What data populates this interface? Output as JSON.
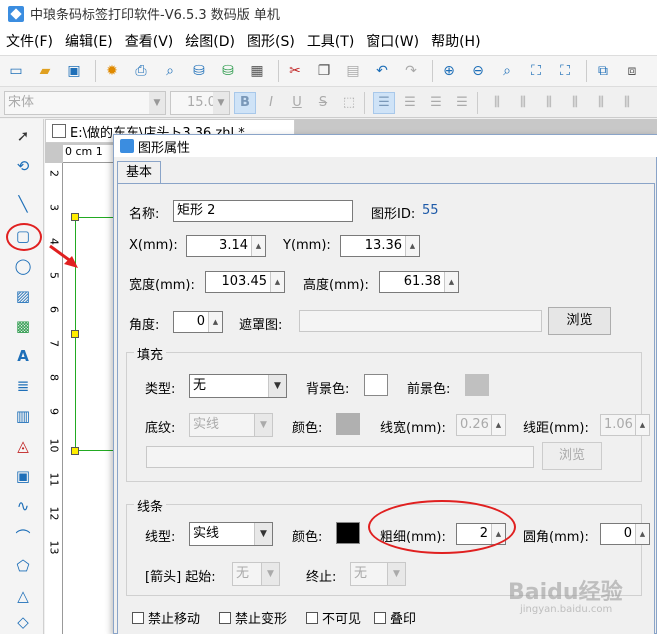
{
  "app": {
    "title": "中琅条码标签打印软件-V6.5.3 数码版 单机"
  },
  "menu": [
    "文件(F)",
    "编辑(E)",
    "查看(V)",
    "绘图(D)",
    "图形(S)",
    "工具(T)",
    "窗口(W)",
    "帮助(H)"
  ],
  "fontbar": {
    "font": "宋体",
    "size": "15.0",
    "bold": "B",
    "italic": "I",
    "underline": "U",
    "strike": "S"
  },
  "document": {
    "tab_title": "E:\\做的东东\\店头ト3.36.zhl *",
    "ruler_unit": "0 cm 1",
    "ruler_numbers": [
      "2",
      "3",
      "4",
      "5",
      "6",
      "7",
      "8",
      "9",
      "10",
      "11",
      "12",
      "13"
    ]
  },
  "dialog": {
    "title": "图形属性",
    "tab": "基本",
    "name_label": "名称:",
    "name_value": "矩形 2",
    "id_label": "图形ID:",
    "id_value": "55",
    "x_label": "X(mm):",
    "x_value": "3.14",
    "y_label": "Y(mm):",
    "y_value": "13.36",
    "width_label": "宽度(mm):",
    "width_value": "103.45",
    "height_label": "高度(mm):",
    "height_value": "61.38",
    "angle_label": "角度:",
    "angle_value": "0",
    "mask_label": "遮罩图:",
    "browse_label": "浏览",
    "fill": {
      "title": "填充",
      "type_label": "类型:",
      "type_value": "无",
      "bg_label": "背景色:",
      "fg_label": "前景色:",
      "pattern_label": "底纹:",
      "pattern_value": "实线",
      "color_label": "颜色:",
      "line_width_label": "线宽(mm):",
      "line_width_value": "0.26",
      "line_spacing_label": "线距(mm):",
      "line_spacing_value": "1.06",
      "browse_label": "浏览"
    },
    "line": {
      "title": "线条",
      "type_label": "线型:",
      "type_value": "实线",
      "color_label": "颜色:",
      "thickness_label": "粗细(mm):",
      "thickness_value": "2",
      "corner_label": "圆角(mm):",
      "corner_value": "0",
      "arrow_label": "[箭头] 起始:",
      "arrow_start_value": "无",
      "arrow_end_label": "终止:",
      "arrow_end_value": "无"
    },
    "options": [
      "禁止移动",
      "禁止变形",
      "不可见",
      "叠印"
    ]
  },
  "colors": {
    "bg_color": "#ffffff",
    "fg_color": "#c0c0c0",
    "pattern_color": "#b0b0b0",
    "line_color": "#000000",
    "accent": "#e02020"
  },
  "watermark": {
    "text": "Baidu经验",
    "sub": "jingyan.baidu.com"
  }
}
